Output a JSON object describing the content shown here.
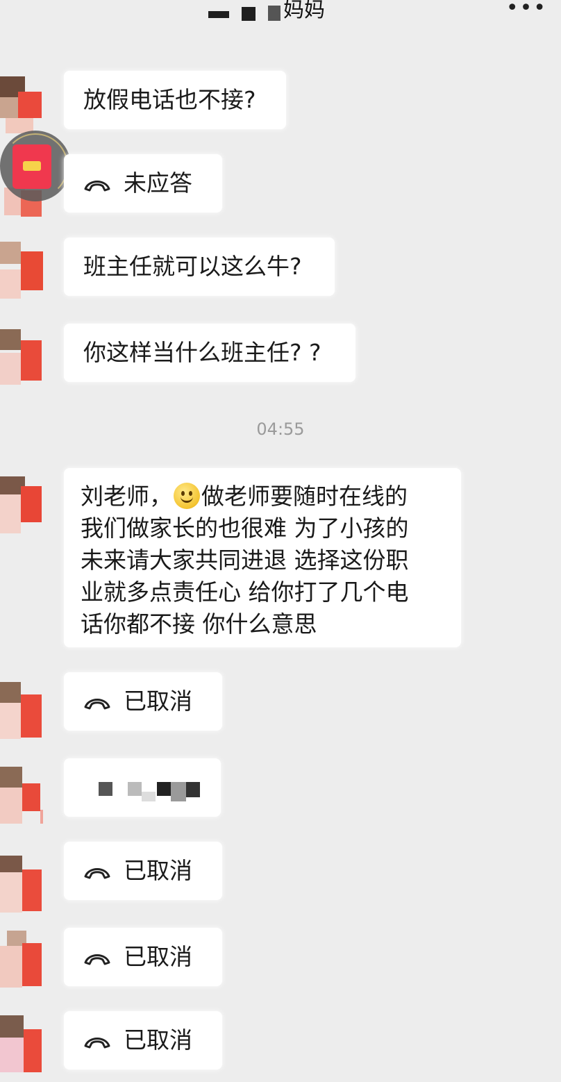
{
  "header": {
    "title_visible": "妈妈",
    "more_icon": "more-icon"
  },
  "messages": [
    {
      "type": "text",
      "text": "放假电话也不接?"
    },
    {
      "type": "call",
      "text": "未应答",
      "icon": "phone-hangup-icon"
    },
    {
      "type": "text",
      "text": "班主任就可以这么牛?"
    },
    {
      "type": "text",
      "text": "你这样当什么班主任? ?"
    },
    {
      "type": "timestamp",
      "text": "04:55"
    },
    {
      "type": "long",
      "lines": [
        {
          "before": "刘老师，",
          "emoji": "smile-emoji-icon",
          "after": "做老师要随时在线的"
        },
        {
          "text": "我们做家长的也很难 为了小孩的"
        },
        {
          "text": "未来请大家共同进退 选择这份职"
        },
        {
          "text": "业就多点责任心 给你打了几个电"
        },
        {
          "text": "话你都不接 你什么意思"
        }
      ]
    },
    {
      "type": "call",
      "text": "已取消",
      "icon": "phone-hangup-icon"
    },
    {
      "type": "redacted",
      "text": ""
    },
    {
      "type": "call",
      "text": "已取消",
      "icon": "phone-hangup-icon"
    },
    {
      "type": "call",
      "text": "已取消",
      "icon": "phone-hangup-icon"
    },
    {
      "type": "call",
      "text": "已取消",
      "icon": "phone-hangup-icon"
    }
  ],
  "overlay": {
    "icon": "red-packet-icon"
  },
  "colors": {
    "background": "#ededed",
    "bubble": "#ffffff",
    "timestamp": "#9a9a9a",
    "red_packet": "#f0384e"
  }
}
